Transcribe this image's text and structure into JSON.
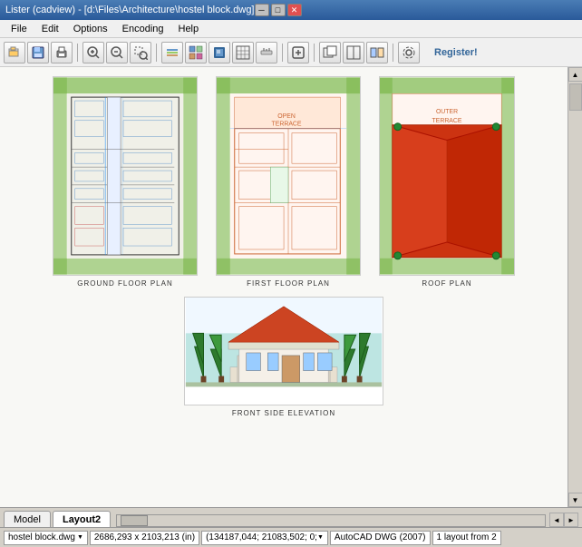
{
  "titlebar": {
    "text": "Lister (cadview) - [d:\\Files\\Architecture\\hostel block.dwg]",
    "min_label": "─",
    "max_label": "□",
    "close_label": "✕"
  },
  "menu": {
    "items": [
      "File",
      "Edit",
      "Options",
      "Encoding",
      "Help"
    ]
  },
  "toolbar": {
    "register_label": "Register!"
  },
  "plans": {
    "ground": {
      "label": "GROUND FLOOR PLAN"
    },
    "first": {
      "label": "FIRST FLOOR PLAN"
    },
    "roof": {
      "label": "ROOF PLAN"
    },
    "elevation": {
      "label": "FRONT SIDE ELEVATION"
    }
  },
  "tabs": [
    {
      "label": "Model",
      "active": false
    },
    {
      "label": "Layout2",
      "active": true
    }
  ],
  "statusbar": {
    "filename": "hostel block.dwg",
    "dimensions": "2686,293 x 2103,213 (in)",
    "coordinates": "(134187,044; 21083,502; 0;",
    "format": "AutoCAD DWG (2007)",
    "layouts": "1 layout from 2"
  }
}
